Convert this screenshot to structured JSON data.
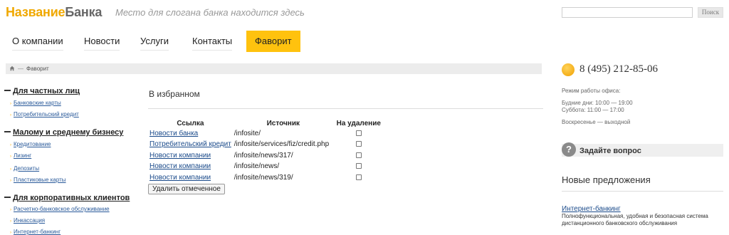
{
  "header": {
    "logo_part1": "Название",
    "logo_part2": "Банка",
    "slogan": "Место для слогана банка находится здесь",
    "search_placeholder": "",
    "search_button": "Поиск"
  },
  "nav": {
    "items": [
      {
        "label": "О компании"
      },
      {
        "label": "Новости"
      },
      {
        "label": "Услуги"
      },
      {
        "label": "Контакты"
      },
      {
        "label": "Фаворит",
        "active": true
      }
    ]
  },
  "breadcrumb": {
    "separator": "—",
    "current": "Фаворит"
  },
  "sidebar": {
    "sections": [
      {
        "title": "Для частных лиц",
        "items": [
          "Банковские карты",
          "Потребительский кредит"
        ]
      },
      {
        "title": "Малому и среднему бизнесу",
        "items": [
          "Кредитование",
          "Лизинг",
          "Депозиты",
          "Пластиковые карты"
        ]
      },
      {
        "title": "Для корпоративных клиентов",
        "items": [
          "Расчетно-банковское обслуживание",
          "Инкассация",
          "Интернет-банкинг"
        ]
      }
    ]
  },
  "main": {
    "title": "В избранном",
    "table": {
      "headers": [
        "Ссылка",
        "Источник",
        "На удаление"
      ],
      "rows": [
        {
          "link": "Новости банка",
          "source": "/infosite/"
        },
        {
          "link": "Потребительский кредит",
          "source": "/infosite/services/fiz/credit.php"
        },
        {
          "link": "Новости компании",
          "source": "/infosite/news/317/"
        },
        {
          "link": "Новости компании",
          "source": "/infosite/news/"
        },
        {
          "link": "Новости компании",
          "source": "/infosite/news/319/"
        }
      ]
    },
    "delete_button": "Удалить отмеченное"
  },
  "contacts": {
    "phone": "8 (495) 212-85-06",
    "hours_title": "Режим работы офиса:",
    "weekdays": "Будние дни: 10:00 — 19:00",
    "saturday": "Суббота: 11:00 — 17:00",
    "sunday": "Воскресенье — выходной"
  },
  "ask": {
    "label": "Задайте вопрос"
  },
  "offers": {
    "title": "Новые предложения",
    "link": "Интернет-банкинг",
    "description": "Полнофункциональная, удобная и безопасная система дистанционного банковского обслуживания"
  },
  "colors": {
    "accent": "#ffc20e",
    "link": "#1a4a8a",
    "breadcrumb_bg": "#ececec"
  }
}
